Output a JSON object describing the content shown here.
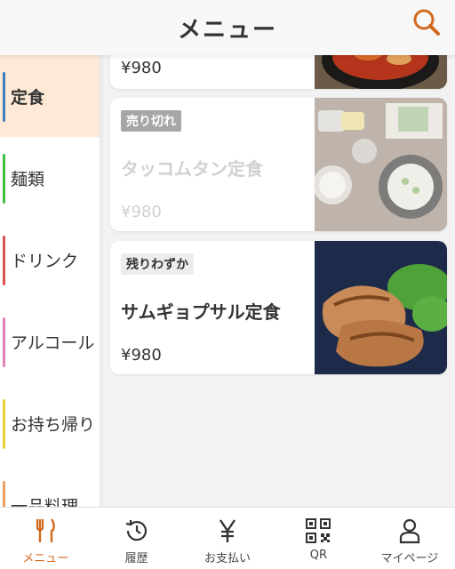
{
  "header": {
    "title": "メニュー",
    "search_icon": "search-icon"
  },
  "accent_color": "#d2691e",
  "categories": [
    {
      "label": "定食",
      "color": "#3f7fbf",
      "active": true
    },
    {
      "label": "麺類",
      "color": "#3fbf3f",
      "active": false
    },
    {
      "label": "ドリンク",
      "color": "#d9534f",
      "active": false
    },
    {
      "label": "アルコール",
      "color": "#e07fb7",
      "active": false
    },
    {
      "label": "お持ち帰り",
      "color": "#e8d23a",
      "active": false
    },
    {
      "label": "一品料理",
      "color": "#e8a060",
      "active": false
    }
  ],
  "menu_items": [
    {
      "name": "",
      "price": "¥980",
      "badge": "",
      "photo_icon": "stew-photo"
    },
    {
      "name": "タッコムタン定食",
      "price": "¥980",
      "badge": "売り切れ",
      "status": "sold-out",
      "photo_icon": "soup-set-photo"
    },
    {
      "name": "サムギョプサル定食",
      "price": "¥980",
      "badge": "残りわずか",
      "status": "few-left",
      "photo_icon": "grilled-pork-photo"
    }
  ],
  "tabs": [
    {
      "label": "メニュー",
      "icon": "fork-knife-icon",
      "active": true
    },
    {
      "label": "履歴",
      "icon": "history-icon",
      "active": false
    },
    {
      "label": "お支払い",
      "icon": "yen-icon",
      "active": false
    },
    {
      "label": "QR",
      "icon": "qr-code-icon",
      "active": false
    },
    {
      "label": "マイページ",
      "icon": "user-icon",
      "active": false
    }
  ]
}
